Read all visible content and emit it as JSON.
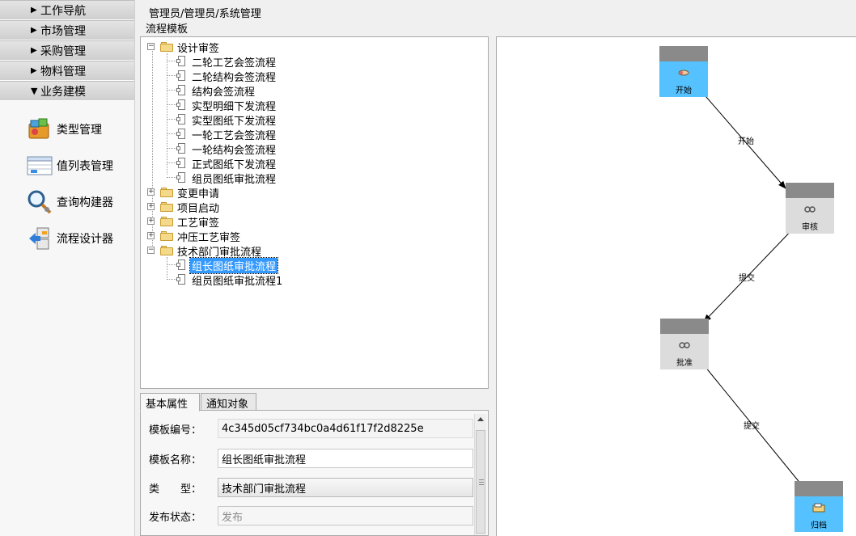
{
  "nav": {
    "headers": [
      {
        "label": "工作导航",
        "arrow": "▶"
      },
      {
        "label": "市场管理",
        "arrow": "▶"
      },
      {
        "label": "采购管理",
        "arrow": "▶"
      },
      {
        "label": "物料管理",
        "arrow": "▶"
      },
      {
        "label": "业务建模",
        "arrow": "▼"
      }
    ],
    "items": [
      {
        "label": "类型管理",
        "icon": "type-management-icon"
      },
      {
        "label": "值列表管理",
        "icon": "value-list-icon"
      },
      {
        "label": "查询构建器",
        "icon": "query-builder-icon"
      },
      {
        "label": "流程设计器",
        "icon": "flow-designer-icon"
      }
    ]
  },
  "breadcrumb": "管理员/管理员/系统管理",
  "template_title": "流程模板",
  "tree": {
    "groups": [
      {
        "label": "设计审签",
        "expanded": true,
        "children": [
          "二轮工艺会签流程",
          "二轮结构会签流程",
          "结构会签流程",
          "实型明细下发流程",
          "实型图纸下发流程",
          "一轮工艺会签流程",
          "一轮结构会签流程",
          "正式图纸下发流程",
          "组员图纸审批流程"
        ]
      },
      {
        "label": "变更申请",
        "expanded": false,
        "children": []
      },
      {
        "label": "项目启动",
        "expanded": false,
        "children": []
      },
      {
        "label": "工艺审签",
        "expanded": false,
        "children": []
      },
      {
        "label": "冲压工艺审签",
        "expanded": false,
        "children": []
      },
      {
        "label": "技术部门审批流程",
        "expanded": true,
        "children": [
          "组长图纸审批流程",
          "组员图纸审批流程1"
        ]
      }
    ],
    "selected": "组长图纸审批流程"
  },
  "props": {
    "tabs": [
      "基本属性",
      "通知对象"
    ],
    "active_tab": "基本属性",
    "fields": [
      {
        "label": "模板编号：",
        "value": "4c345d05cf734bc0a4d61f17f2d8225e"
      },
      {
        "label": "模板名称：",
        "value": "组长图纸审批流程"
      },
      {
        "label": "类　　型：",
        "value": "技术部门审批流程"
      },
      {
        "label": "发布状态：",
        "value": "发布"
      }
    ]
  },
  "workflow": {
    "nodes": [
      {
        "label": "开始",
        "style": "blue",
        "icon": "start-icon"
      },
      {
        "label": "审核",
        "style": "gray",
        "icon": "review-icon"
      },
      {
        "label": "批准",
        "style": "gray",
        "icon": "approve-icon"
      },
      {
        "label": "归档",
        "style": "blue",
        "icon": "archive-icon"
      }
    ],
    "edges": [
      "开始",
      "提交",
      "提交"
    ]
  },
  "colors": {
    "selection": "#3399ff",
    "node_blue": "#55c2ff",
    "node_gray": "#dcdcdc",
    "node_header": "#8a8a8a"
  }
}
